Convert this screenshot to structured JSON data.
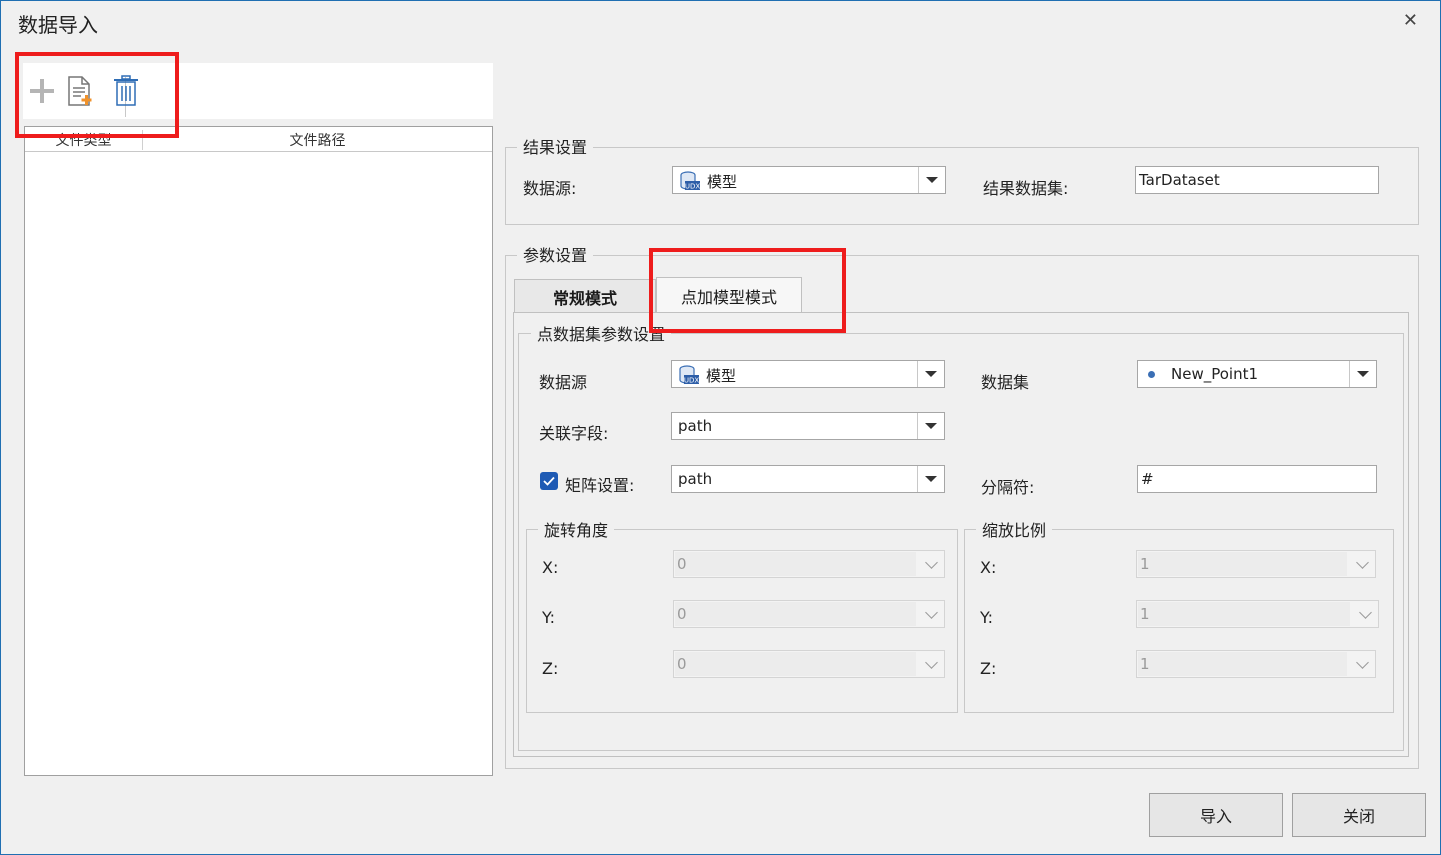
{
  "window": {
    "title": "数据导入"
  },
  "file_list": {
    "columns": [
      "文件类型",
      "文件路径"
    ]
  },
  "result_settings": {
    "group_title": "结果设置",
    "datasource_label": "数据源:",
    "datasource_value": "模型",
    "result_dataset_label": "结果数据集:",
    "result_dataset_value": "TarDataset"
  },
  "param_settings": {
    "group_title": "参数设置",
    "tabs": [
      "常规模式",
      "点加模型模式"
    ],
    "active_tab": "点加模型模式",
    "point_group_title": "点数据集参数设置",
    "datasource_label": "数据源",
    "datasource_value": "模型",
    "dataset_label": "数据集",
    "dataset_value": "New_Point1",
    "link_field_label": "关联字段:",
    "link_field_value": "path",
    "matrix_label": "矩阵设置:",
    "matrix_checked": true,
    "matrix_value": "path",
    "separator_label": "分隔符:",
    "separator_value": "#",
    "rotation": {
      "title": "旋转角度",
      "x_label": "X:",
      "x_value": "0",
      "y_label": "Y:",
      "y_value": "0",
      "z_label": "Z:",
      "z_value": "0"
    },
    "scale": {
      "title": "缩放比例",
      "x_label": "X:",
      "x_value": "1",
      "y_label": "Y:",
      "y_value": "1",
      "z_label": "Z:",
      "z_value": "1"
    }
  },
  "footer": {
    "import_label": "导入",
    "close_label": "关闭"
  },
  "colors": {
    "highlight_red": "#ee1c1c",
    "checkbox_blue": "#1e5ab4",
    "window_border": "#1f6fb2"
  },
  "icons": [
    "close-icon",
    "add-icon",
    "add-file-icon",
    "delete-icon",
    "datasource-icon",
    "point-icon",
    "dropdown-arrow-icon",
    "check-icon"
  ]
}
